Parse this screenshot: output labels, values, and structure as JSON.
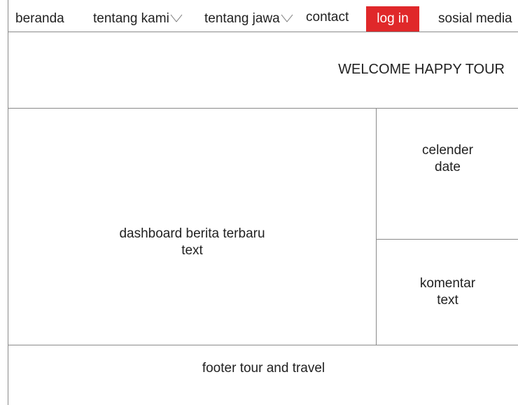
{
  "nav": {
    "items": [
      {
        "label": "beranda"
      },
      {
        "label": "tentang kami"
      },
      {
        "label": "tentang jawa"
      },
      {
        "label": "contact"
      },
      {
        "label": "log in"
      },
      {
        "label": "sosial media"
      }
    ],
    "login_color": "#e0282a"
  },
  "header": {
    "title": "WELCOME HAPPY TOUR"
  },
  "main": {
    "dashboard_title": "dashboard berita terbaru",
    "dashboard_sub": "text"
  },
  "sidebar": {
    "calendar_title": "celender",
    "calendar_sub": "date",
    "comment_title": "komentar",
    "comment_sub": "text"
  },
  "footer": {
    "text": "footer tour and travel"
  }
}
